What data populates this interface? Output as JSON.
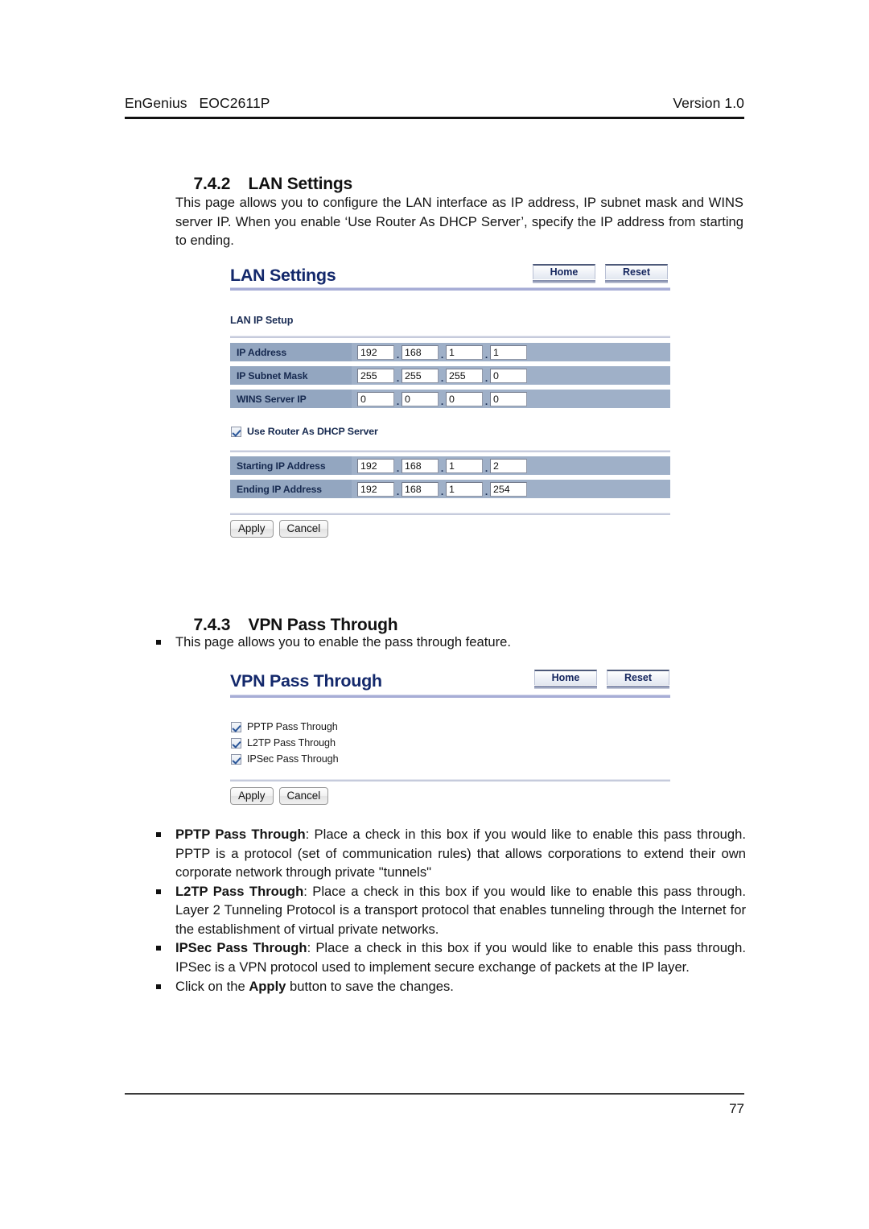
{
  "header": {
    "left": "EnGenius   EOC2611P",
    "right": "Version 1.0"
  },
  "footer": {
    "page_number": "77"
  },
  "sections": {
    "lan": {
      "number": "7.4.2",
      "title": "LAN Settings",
      "paragraph": "This page allows you to configure the LAN interface as IP address, IP subnet mask and WINS server IP. When you enable ‘Use Router As DHCP Server’, specify the IP address from starting to ending."
    },
    "vpn": {
      "number": "7.4.3",
      "title": "VPN Pass Through",
      "intro_bullet": "This page allows you to enable the pass through feature."
    }
  },
  "lan_panel": {
    "title": "LAN Settings",
    "home_label": "Home",
    "reset_label": "Reset",
    "subheading": "LAN IP Setup",
    "rows": [
      {
        "label": "IP Address",
        "octets": [
          "192",
          "168",
          "1",
          "1"
        ]
      },
      {
        "label": "IP Subnet Mask",
        "octets": [
          "255",
          "255",
          "255",
          "0"
        ]
      },
      {
        "label": "WINS Server IP",
        "octets": [
          "0",
          "0",
          "0",
          "0"
        ]
      }
    ],
    "dhcp_checkbox": {
      "label": "Use Router As DHCP Server",
      "checked": true
    },
    "dhcp_rows": [
      {
        "label": "Starting IP Address",
        "octets": [
          "192",
          "168",
          "1",
          "2"
        ]
      },
      {
        "label": "Ending IP Address",
        "octets": [
          "192",
          "168",
          "1",
          "254"
        ]
      }
    ],
    "apply_label": "Apply",
    "cancel_label": "Cancel",
    "separator": "."
  },
  "vpn_panel": {
    "title": "VPN Pass Through",
    "home_label": "Home",
    "reset_label": "Reset",
    "checkboxes": [
      {
        "label": "PPTP Pass Through",
        "checked": true
      },
      {
        "label": "L2TP Pass Through",
        "checked": true
      },
      {
        "label": "IPSec Pass Through",
        "checked": true
      }
    ],
    "apply_label": "Apply",
    "cancel_label": "Cancel"
  },
  "vpn_bullets": [
    {
      "term": "PPTP Pass Through",
      "text": ": Place a check in this box if you would like to enable this pass through. PPTP is a protocol (set of communication rules) that allows corporations to extend their own corporate network through private \"tunnels\""
    },
    {
      "term": "L2TP Pass Through",
      "text": ": Place a check in this box if you would like to enable this pass through. Layer 2 Tunneling Protocol is a transport protocol that enables tunneling through the Internet for the establishment of virtual private networks."
    },
    {
      "term": "IPSec Pass Through",
      "text": ": Place a check in this box if you would like to enable this pass through. IPSec is a VPN protocol used to implement secure exchange of packets at the IP layer."
    }
  ],
  "apply_note": {
    "pre": "Click on the ",
    "term": "Apply",
    "post": " button to save the changes."
  },
  "colors": {
    "panel_title": "#13286b",
    "row_bg": "#9fb0c8",
    "row_label_bg": "#93a6c0",
    "divider": "#c6cbdc"
  }
}
